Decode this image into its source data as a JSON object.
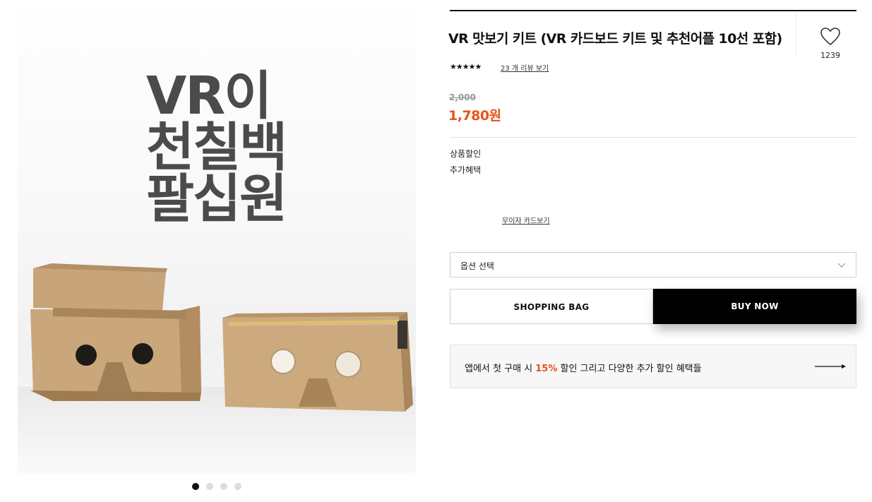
{
  "gallery": {
    "hero_lines": [
      "VR이",
      "천칠백",
      "팔십원"
    ],
    "slide_count": 4,
    "active_slide": 1
  },
  "product": {
    "title": "VR 맛보기 키트 (VR 카드보드 키트 및 추천어플 10선 포함)",
    "like_count": "1239",
    "rating_stars": "★★★★★",
    "review_link": "23 개 리뷰 보기",
    "original_price": "2,000",
    "sale_price": "1,780원"
  },
  "benefits": {
    "product_discount": "상품할인",
    "extra_benefit": "추가혜택",
    "card_link": "무이자 카드보기"
  },
  "option_select": {
    "placeholder": "옵션 선택"
  },
  "actions": {
    "shopping_bag": "SHOPPING BAG",
    "buy_now": "BUY NOW"
  },
  "promo": {
    "text_before": "앱에서 첫 구매 시 ",
    "highlight": "15%",
    "text_after": " 할인 그리고 다양한 추가 할인 혜택들"
  },
  "colors": {
    "accent": "#e8531b",
    "buy_button": "#000000"
  },
  "icons": {
    "heart": "heart-outline-icon",
    "chevron": "chevron-down-icon",
    "arrow": "arrow-right-icon"
  }
}
